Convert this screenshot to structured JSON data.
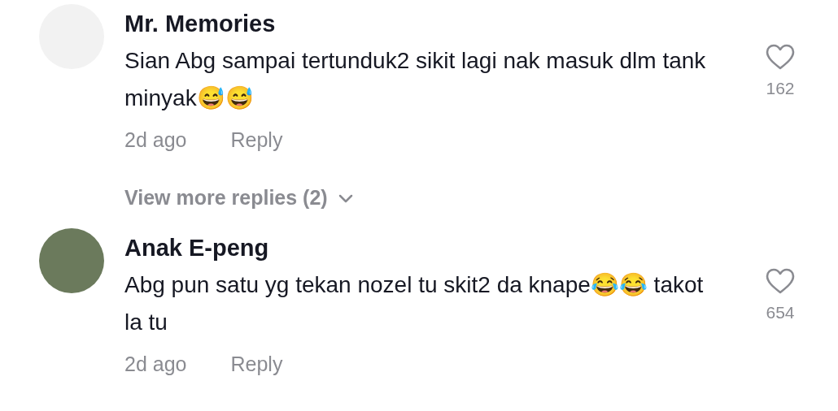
{
  "comments": [
    {
      "author": "Mr. Memories",
      "kind": "logo",
      "text": "Sian Abg sampai tertunduk2 sikit lagi nak masuk dlm tank minyak😅😅",
      "liked": false,
      "likes": "162",
      "time": "2d ago",
      "reply": "Reply",
      "more_replies": "View more replies (2)"
    },
    {
      "author": "Anak E-peng",
      "kind": "photo",
      "text": "Abg pun satu yg tekan nozel tu skit2 da knape😂😂 takot la tu",
      "liked": false,
      "likes": "654",
      "time": "2d ago",
      "reply": "Reply"
    }
  ]
}
